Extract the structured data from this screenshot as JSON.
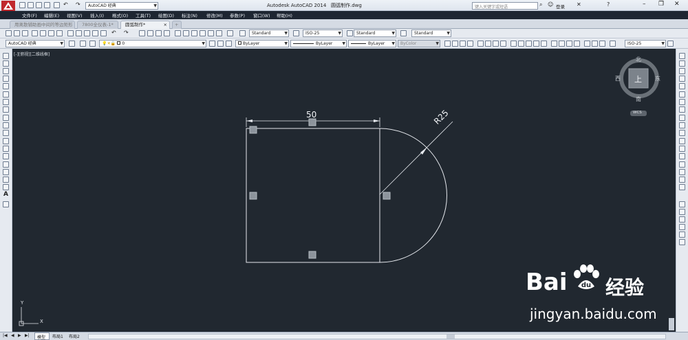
{
  "app": {
    "title": "Autodesk AutoCAD 2014",
    "filename": "圆弧制作.dwg",
    "workspace": "AutoCAD 经典",
    "search_placeholder": "键入关键字或短语",
    "login_label": "登录",
    "window_controls": [
      "minimize-icon",
      "restore-icon",
      "close-icon"
    ]
  },
  "menu": {
    "items": [
      "文件(F)",
      "编辑(E)",
      "视图(V)",
      "插入(I)",
      "格式(O)",
      "工具(T)",
      "绘图(D)",
      "标注(N)",
      "修改(M)",
      "参数(P)",
      "窗口(W)",
      "帮助(H)"
    ]
  },
  "doc_tabs": [
    {
      "label": "用离散辅助画中间的等边矩形",
      "active": false
    },
    {
      "label": "7800全仪表-1*",
      "active": false
    },
    {
      "label": "圆弧制作*",
      "active": true
    }
  ],
  "toolbar1": {
    "text_style": "Standard",
    "dim_style": "ISO-25",
    "table_style": "Standard",
    "multileader_style": "Standard"
  },
  "toolbar2": {
    "workspace": "AutoCAD 经典",
    "layer": "0",
    "color": "ByLayer",
    "linetype": "ByLayer",
    "lineweight": "ByLayer",
    "plotstyle": "ByColor",
    "dim_style_right": "ISO-25"
  },
  "viewport": {
    "label": "[-][俯视][二维线框]",
    "background": "#212830"
  },
  "viewcube": {
    "north": "北",
    "south": "南",
    "east": "东",
    "west": "西",
    "top": "上",
    "wcs": "WCS"
  },
  "drawing": {
    "dimension_linear": "50",
    "dimension_radius": "R25",
    "ucs_x": "X",
    "ucs_y": "Y"
  },
  "layout_tabs": [
    "模型",
    "布局1",
    "布局2"
  ],
  "watermark": {
    "brand": "Bai",
    "brand_suffix": "经验",
    "url": "jingyan.baidu.com"
  }
}
